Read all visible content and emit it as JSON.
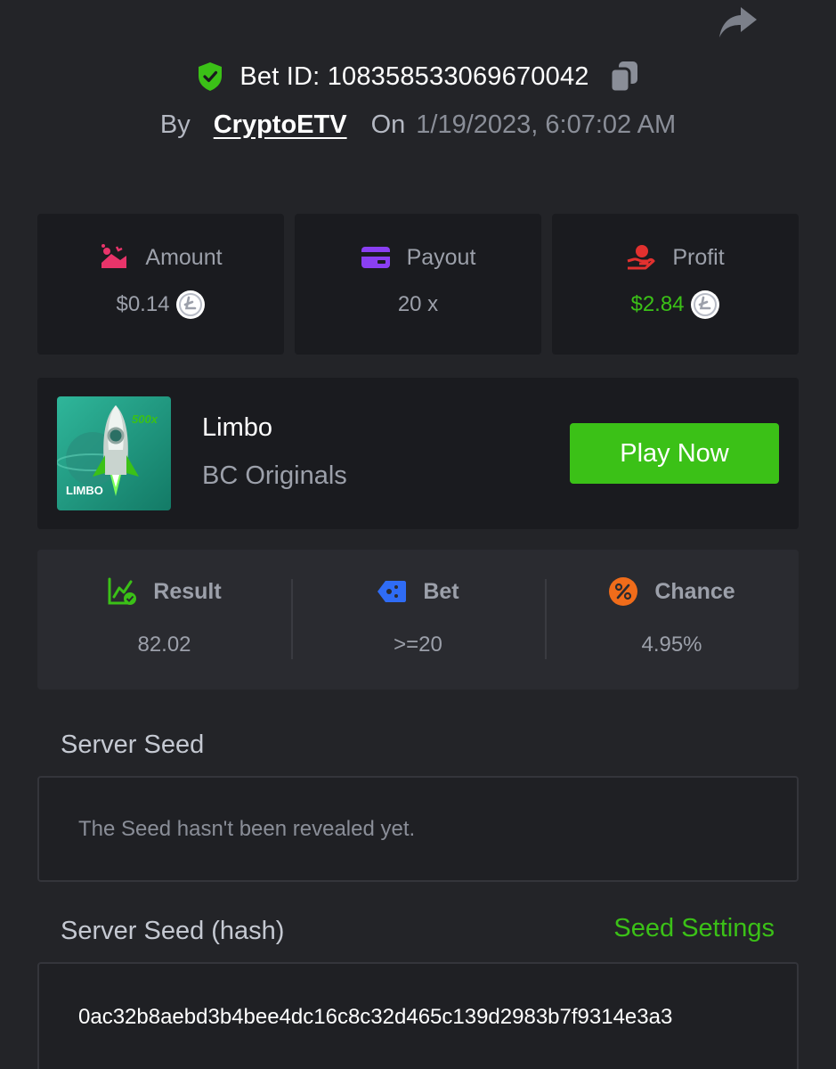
{
  "header": {
    "bet_id_label": "Bet ID: 108358533069670042",
    "by_label": "By",
    "author": "CryptoETV",
    "on_label": "On",
    "date": "1/19/2023, 6:07:02 AM"
  },
  "stats": [
    {
      "label": "Amount",
      "value": "$0.14",
      "icon": "amount-icon",
      "coin": "ltc-coin-icon"
    },
    {
      "label": "Payout",
      "value": "20 x",
      "icon": "payout-card-icon"
    },
    {
      "label": "Profit",
      "value": "$2.84",
      "icon": "profit-hand-icon",
      "coin": "ltc-coin-icon"
    }
  ],
  "game": {
    "name": "Limbo",
    "provider": "BC Originals",
    "thumb_badge": "500x",
    "thumb_label": "LIMBO",
    "play_label": "Play Now"
  },
  "results": [
    {
      "label": "Result",
      "value": "82.02",
      "icon": "result-chart-icon"
    },
    {
      "label": "Bet",
      "value": ">=20",
      "icon": "bet-tag-icon"
    },
    {
      "label": "Chance",
      "value": "4.95%",
      "icon": "percent-icon"
    }
  ],
  "server_seed": {
    "title": "Server Seed",
    "message": "The Seed hasn't been revealed yet."
  },
  "server_seed_hash": {
    "title": "Server Seed (hash)",
    "settings_link": "Seed Settings",
    "value": "0ac32b8aebd3b4bee4dc16c8c32d465c139d2983b7f9314e3a3"
  },
  "colors": {
    "background": "#232428",
    "card": "#1a1b1f",
    "accent_green": "#3bc117",
    "muted_text": "#9ca0aa"
  }
}
